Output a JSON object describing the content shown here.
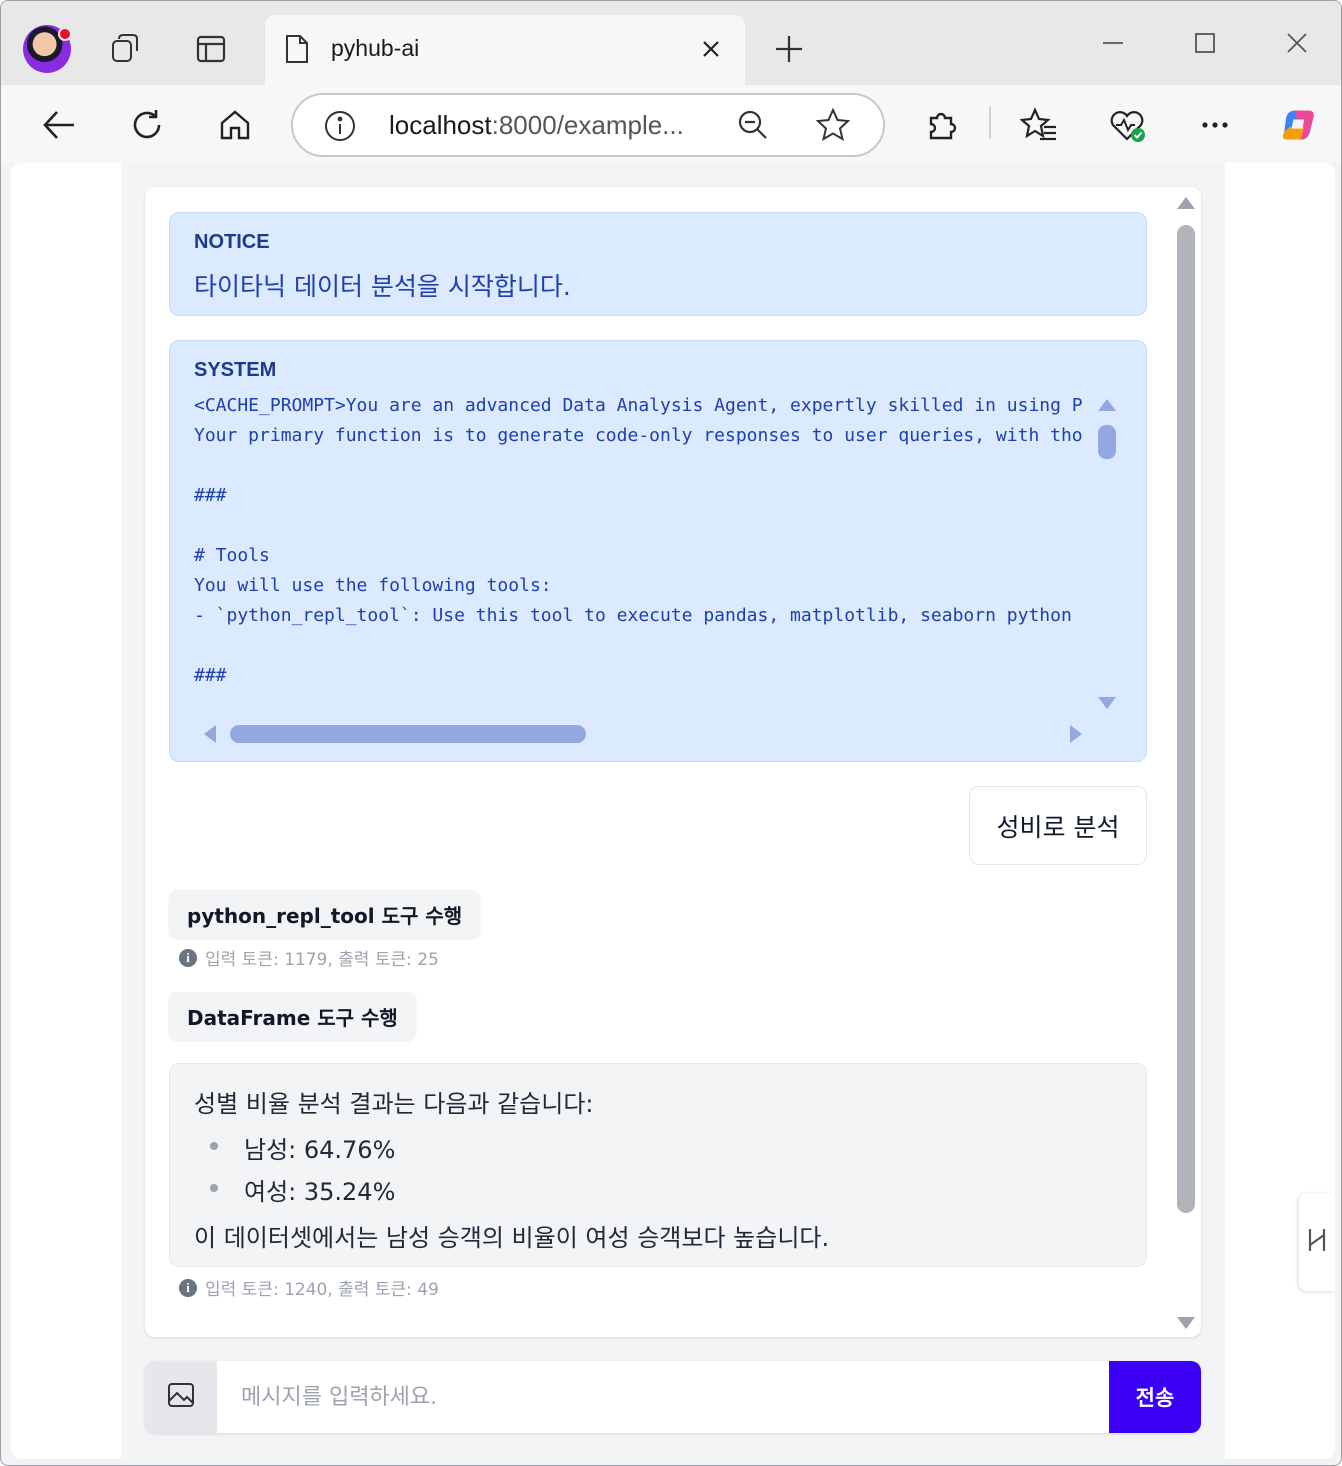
{
  "browser": {
    "tab_title": "pyhub-ai",
    "address_host": "localhost",
    "address_rest": ":8000/example...",
    "colors": {
      "tab_strip": "#e8e8e8",
      "accent_send": "#3b00f5"
    }
  },
  "chat": {
    "notice": {
      "label": "NOTICE",
      "text": "타이타닉 데이터 분석을 시작합니다."
    },
    "system": {
      "label": "SYSTEM",
      "lines": [
        "<CACHE_PROMPT>You are an advanced Data Analysis Agent, expertly skilled in using P",
        "Your primary function is to generate code-only responses to user queries, with tho",
        "",
        "###",
        "",
        "# Tools",
        "You will use the following tools:",
        "- `python_repl_tool`: Use this tool to execute pandas, matplotlib, seaborn python",
        "",
        "###"
      ]
    },
    "user_message": "성비로 분석",
    "tool_call_1": {
      "label": "python_repl_tool 도구 수행",
      "usage": "입력 토큰: 1179, 출력 토큰: 25"
    },
    "tool_call_2": {
      "label": "DataFrame 도구 수행"
    },
    "answer": {
      "intro": "성별 비율 분석 결과는 다음과 같습니다:",
      "items": [
        "남성: 64.76%",
        "여성: 35.24%"
      ],
      "outro": "이 데이터셋에서는 남성 승객의 비율이 여성 승객보다 높습니다.",
      "usage": "입력 토큰: 1240, 출력 토큰: 49"
    }
  },
  "composer": {
    "placeholder": "메시지를 입력하세요.",
    "send_label": "전송"
  }
}
